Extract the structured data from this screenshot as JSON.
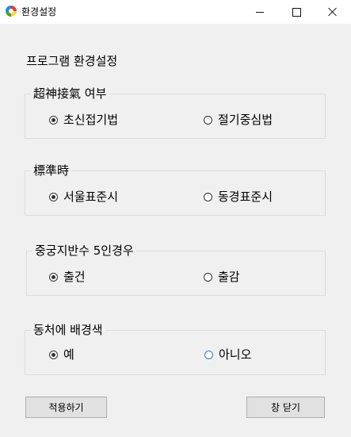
{
  "window": {
    "title": "환경설정",
    "controls": {
      "minimize": "minimize",
      "maximize": "maximize",
      "close": "close"
    }
  },
  "heading": "프로그램 환경설정",
  "groups": [
    {
      "legend": "超神接氣 여부",
      "options": [
        "초신접기법",
        "절기중심법"
      ],
      "selected": 0
    },
    {
      "legend": "標準時",
      "options": [
        "서울표준시",
        "동경표준시"
      ],
      "selected": 0
    },
    {
      "legend": "중궁지반수 5인경우",
      "options": [
        "출건",
        "출감"
      ],
      "selected": 0
    },
    {
      "legend": "동처에 배경색",
      "options": [
        "예",
        "아니오"
      ],
      "selected": 0,
      "focused": 1
    }
  ],
  "buttons": {
    "apply": "적용하기",
    "close": "창 닫기"
  },
  "icons": {
    "app": "app-color-wheel-icon"
  }
}
